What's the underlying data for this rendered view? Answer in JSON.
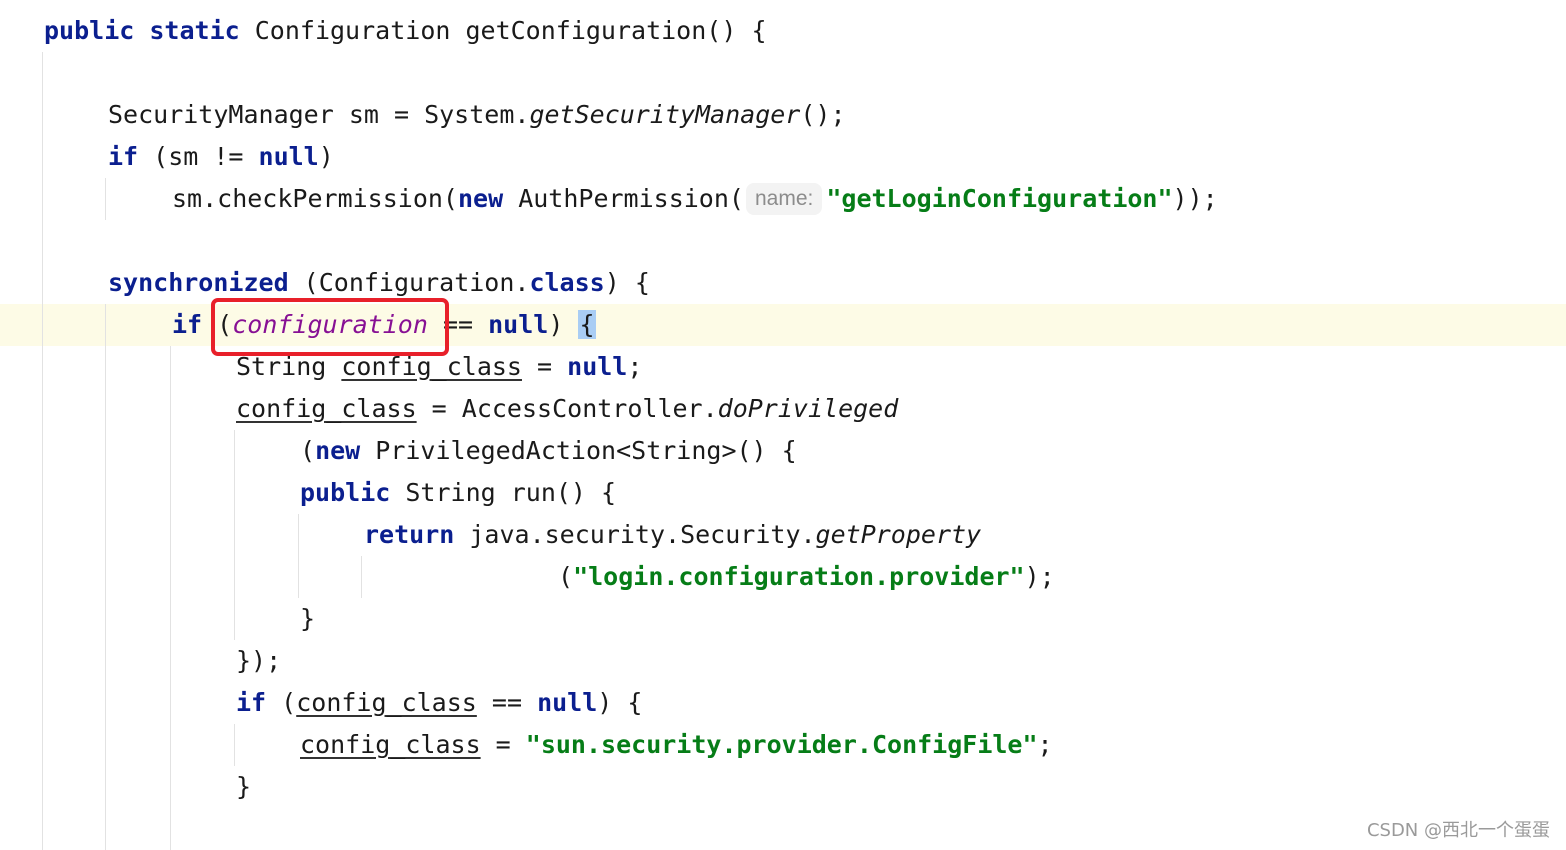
{
  "editor": {
    "lines": {
      "l1": {
        "kw1": "public",
        "kw2": "static",
        "rest": "Configuration getConfiguration() {"
      },
      "l3": {
        "a": "SecurityManager sm = System.",
        "b": "getSecurityManager",
        "c": "();"
      },
      "l4": {
        "kw": "if",
        "a": " (sm != ",
        "kw2": "null",
        "b": ")"
      },
      "l5": {
        "a": "sm.checkPermission(",
        "kw": "new",
        "b": " AuthPermission(",
        "hint": "name:",
        "str": "\"getLoginConfiguration\"",
        "c": "));"
      },
      "l7": {
        "kw": "synchronized",
        "a": " (Configuration.",
        "kw2": "class",
        "b": ") {"
      },
      "l8": {
        "kw": "if",
        "a": " (",
        "fld": "configuration",
        "b": " == ",
        "kw2": "null",
        "c": ") ",
        "brace": "{"
      },
      "l9": {
        "a": "String ",
        "ul": "config_class",
        "b": " = ",
        "kw": "null",
        "c": ";"
      },
      "l10": {
        "ul": "config_class",
        "a": " = AccessController.",
        "b": "doPrivileged"
      },
      "l11": {
        "a": "(",
        "kw": "new",
        "b": " PrivilegedAction<String>() {"
      },
      "l12": {
        "kw": "public",
        "a": " String run() {"
      },
      "l13": {
        "kw": "return",
        "a": " java.security.Security.",
        "b": "getProperty"
      },
      "l14": {
        "a": "(",
        "str": "\"login.configuration.provider\"",
        "b": ");"
      },
      "l15": {
        "a": "}"
      },
      "l16": {
        "a": "});"
      },
      "l17": {
        "kw": "if",
        "a": " (",
        "ul": "config_class",
        "b": " == ",
        "kw2": "null",
        "c": ") {"
      },
      "l18": {
        "ul": "config_class",
        "a": " = ",
        "str": "\"sun.security.provider.ConfigFile\"",
        "b": ";"
      },
      "l19": {
        "a": "}"
      }
    }
  },
  "watermark": "CSDN @西北一个蛋蛋",
  "colors": {
    "keyword": "#0b1f8f",
    "string": "#067d17",
    "field": "#871094",
    "annotation_box": "#e8202a",
    "current_line": "#fdfbe6"
  }
}
